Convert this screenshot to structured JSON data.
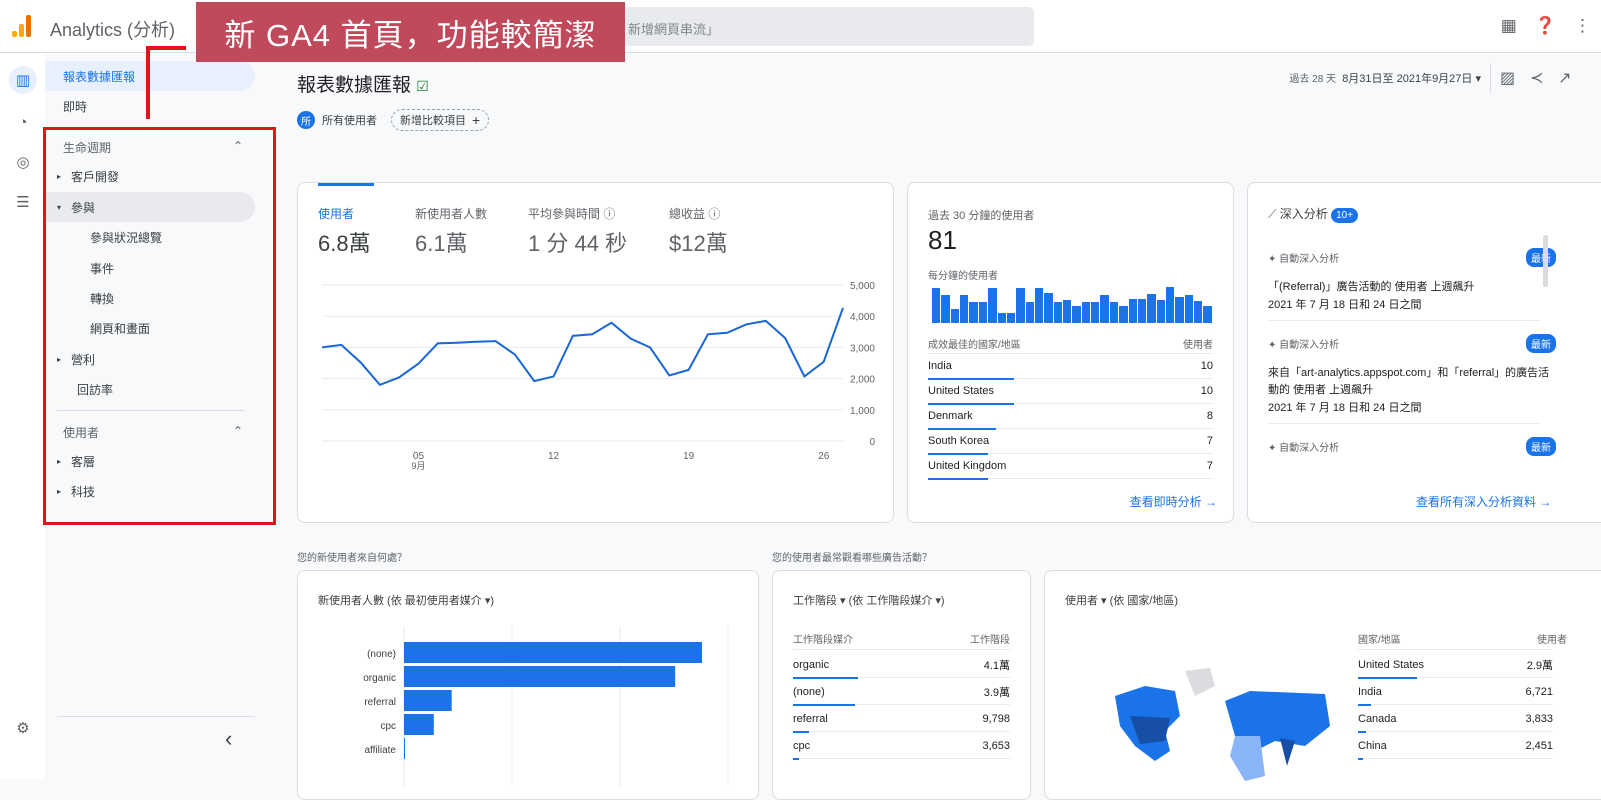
{
  "header": {
    "app_title": "Analytics (分析)",
    "search_placeholder": "新增網頁串流」",
    "icons": [
      "apps-icon",
      "help-icon",
      "more-icon"
    ]
  },
  "annotation": {
    "banner": "新 GA4 首頁，功能較簡潔"
  },
  "sidebar": {
    "top_items": [
      {
        "label": "報表數據匯報",
        "selected": true
      },
      {
        "label": "即時"
      }
    ],
    "section1": {
      "title": "生命週期",
      "items": [
        {
          "label": "客戶開發",
          "caret": "▸"
        },
        {
          "label": "參與",
          "caret": "▾"
        },
        {
          "label": "參與狀況總覽"
        },
        {
          "label": "事件"
        },
        {
          "label": "轉換"
        },
        {
          "label": "網頁和畫面"
        },
        {
          "label": "營利",
          "caret": "▸"
        },
        {
          "label": "回訪率"
        }
      ]
    },
    "section2": {
      "title": "使用者",
      "items": [
        {
          "label": "客層",
          "caret": "▸"
        },
        {
          "label": "科技",
          "caret": "▸"
        }
      ]
    },
    "collapse": "‹"
  },
  "page": {
    "title": "報表數據匯報",
    "segment_badge": "所",
    "segment": "所有使用者",
    "add_compare": "新增比較項目",
    "date_prefix": "過去 28 天",
    "date_range": "8月31日至 2021年9月27日"
  },
  "kpis": [
    {
      "label": "使用者",
      "value": "6.8萬"
    },
    {
      "label": "新使用者人數",
      "value": "6.1萬"
    },
    {
      "label": "平均參與時間",
      "value": "1 分 44 秒"
    },
    {
      "label": "總收益",
      "value": "$12萬"
    }
  ],
  "chart_data": {
    "type": "line",
    "series": [
      {
        "name": "使用者",
        "values": [
          3000,
          3080,
          2520,
          1800,
          2040,
          2480,
          3130,
          3150,
          3180,
          3200,
          2770,
          1920,
          2070,
          3370,
          3420,
          3790,
          3280,
          3000,
          2100,
          2280,
          3420,
          3470,
          3740,
          3850,
          3300,
          2070,
          2540,
          4270
        ]
      }
    ],
    "x_ticks": [
      {
        "index": 5,
        "label": "05",
        "sub": "9月"
      },
      {
        "index": 12,
        "label": "12"
      },
      {
        "index": 19,
        "label": "19"
      },
      {
        "index": 26,
        "label": "26"
      }
    ],
    "y_ticks": [
      "5,000",
      "4,000",
      "3,000",
      "2,000",
      "1,000",
      "0"
    ],
    "ylim": [
      0,
      5000
    ]
  },
  "realtime": {
    "title": "過去 30 分鐘的使用者",
    "value": "81",
    "per_minute": "每分鐘的使用者",
    "bars": [
      5,
      4,
      2,
      4,
      3,
      3,
      5,
      1.5,
      1.5,
      5,
      3,
      5,
      4.3,
      3,
      3.3,
      2.5,
      3,
      3,
      4,
      3,
      2.5,
      3.5,
      3.5,
      4.2,
      3.3,
      5.2,
      3.8,
      4,
      3.2,
      2.5
    ],
    "col_country": "成效最佳的國家/地區",
    "col_users": "使用者",
    "rows": [
      {
        "country": "India",
        "users": "10",
        "pct": 100
      },
      {
        "country": "United States",
        "users": "10",
        "pct": 100
      },
      {
        "country": "Denmark",
        "users": "8",
        "pct": 80
      },
      {
        "country": "South Korea",
        "users": "7",
        "pct": 70
      },
      {
        "country": "United Kingdom",
        "users": "7",
        "pct": 70
      }
    ],
    "link": "查看即時分析 →"
  },
  "insights": {
    "title": "深入分析",
    "count": "10+",
    "items": [
      {
        "type": "自動深入分析",
        "badge": "最新",
        "text": "「(Referral)」廣告活動的 使用者 上週飆升",
        "date": "2021 年 7 月 18 日和 24 日之間"
      },
      {
        "type": "自動深入分析",
        "badge": "最新",
        "text": "來自「art-analytics.appspot.com」和「referral」的廣告活動的 使用者 上週飆升",
        "date": "2021 年 7 月 18 日和 24 日之間"
      },
      {
        "type": "自動深入分析",
        "badge": "最新"
      }
    ],
    "link": "查看所有深入分析資料 →"
  },
  "questions": {
    "q1": "您的新使用者來自何處？",
    "q2": "您的使用者最常觀看哪些廣告活動？"
  },
  "new_users": {
    "title": "新使用者人數 (依 最初使用者媒介 ▾)",
    "chart_data": {
      "type": "bar",
      "categories": [
        "(none)",
        "organic",
        "referral",
        "cpc",
        "affiliate"
      ],
      "values": [
        100,
        91,
        16,
        10,
        0.3
      ]
    }
  },
  "sessions": {
    "title": "工作階段 ▾ (依 工作階段媒介 ▾)",
    "col1": "工作階段媒介",
    "col2": "工作階段",
    "rows": [
      {
        "name": "organic",
        "value": "4.1萬",
        "pct": 100
      },
      {
        "name": "(none)",
        "value": "3.9萬",
        "pct": 95
      },
      {
        "name": "referral",
        "value": "9,798",
        "pct": 24
      },
      {
        "name": "cpc",
        "value": "3,653",
        "pct": 9
      }
    ]
  },
  "geo": {
    "title": "使用者 ▾ (依 國家/地區)",
    "col1": "國家/地區",
    "col2": "使用者",
    "rows": [
      {
        "name": "United States",
        "value": "2.9萬",
        "pct": 100
      },
      {
        "name": "India",
        "value": "6,721",
        "pct": 23
      },
      {
        "name": "Canada",
        "value": "3,833",
        "pct": 13
      },
      {
        "name": "China",
        "value": "2,451",
        "pct": 8
      }
    ]
  },
  "colors": {
    "accent": "#1a73e8",
    "banner": "#c04a5c",
    "annotation": "#e0141a"
  }
}
